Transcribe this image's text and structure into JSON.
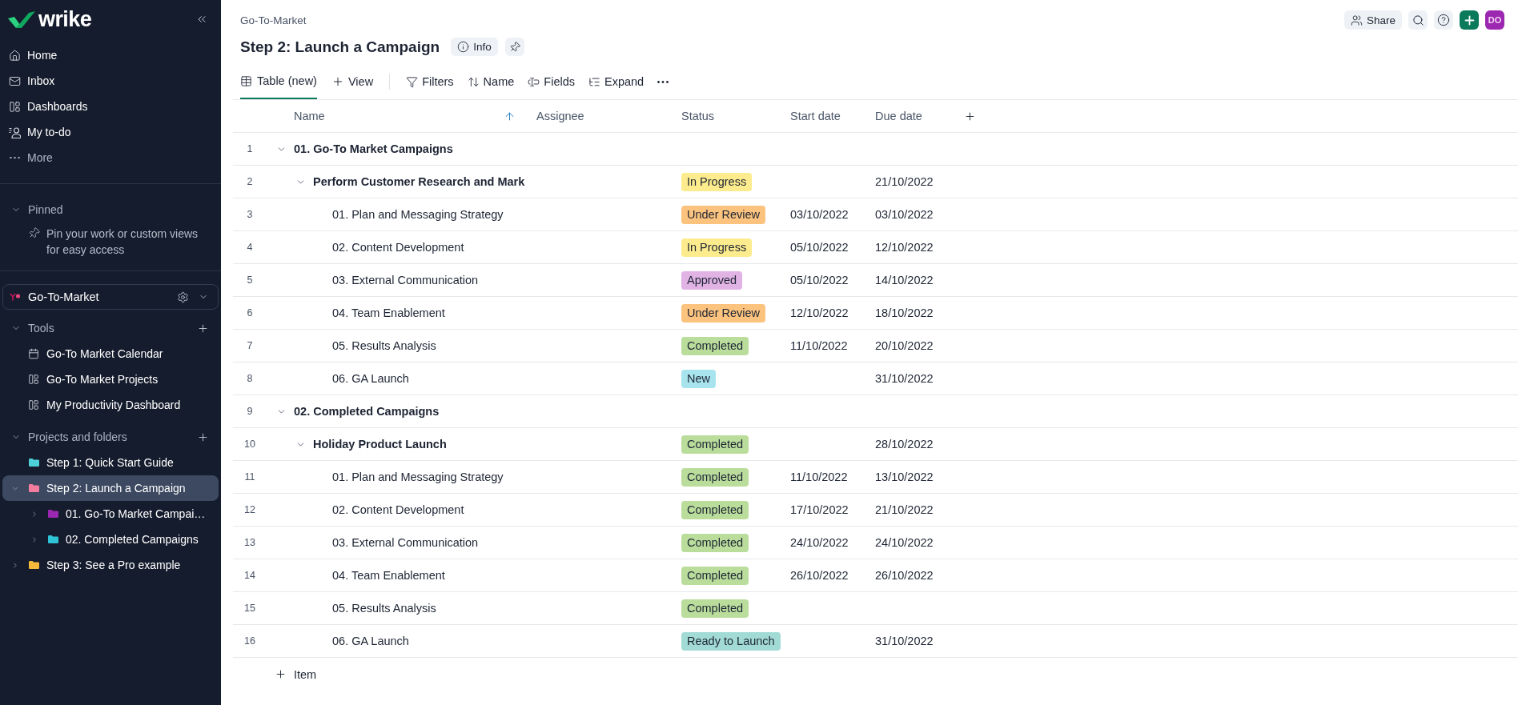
{
  "sidebar": {
    "logo": "wrike",
    "nav": [
      {
        "kind": "home",
        "label": "Home"
      },
      {
        "kind": "inbox",
        "label": "Inbox"
      },
      {
        "kind": "dashboards",
        "label": "Dashboards"
      },
      {
        "kind": "todo",
        "label": "My to-do"
      },
      {
        "kind": "more",
        "label": "More"
      }
    ],
    "pinned": {
      "title": "Pinned",
      "expanded": true,
      "hint": "Pin your work or custom views for easy access"
    },
    "space": {
      "name": "Go-To-Market"
    },
    "tools": {
      "title": "Tools",
      "expanded": true,
      "items": [
        {
          "kind": "calendar",
          "label": "Go-To Market Calendar"
        },
        {
          "kind": "dashboard",
          "label": "Go-To Market Projects"
        },
        {
          "kind": "dashboard",
          "label": "My Productivity Dashboard"
        }
      ]
    },
    "projects": {
      "title": "Projects and folders",
      "expanded": true,
      "items": [
        {
          "label": "Step 1: Quick Start Guide",
          "color": "#4fd1d9",
          "expandable": false,
          "expanded": false,
          "selected": false
        },
        {
          "label": "Step 2: Launch a Campaign",
          "color": "#f47c9c",
          "expandable": true,
          "expanded": true,
          "selected": true,
          "children": [
            {
              "label": "01. Go-To Market Campai…",
              "color": "#9c27b0",
              "expandable": true,
              "expanded": false,
              "selected": false
            },
            {
              "label": "02. Completed Campaigns",
              "color": "#2ec4d6",
              "expandable": true,
              "expanded": false,
              "selected": false
            }
          ]
        },
        {
          "label": "Step 3: See a Pro example",
          "color": "#f6b93b",
          "expandable": true,
          "expanded": false,
          "selected": false
        }
      ]
    }
  },
  "header": {
    "breadcrumb": "Go-To-Market",
    "title": "Step 2: Launch a Campaign",
    "info_button": "Info",
    "share_button": "Share",
    "avatar": "DO"
  },
  "toolbar": {
    "views": [
      {
        "label": "Table (new)",
        "selected": true
      }
    ],
    "add_view": "View",
    "actions": [
      {
        "kind": "filter",
        "label": "Filters"
      },
      {
        "kind": "sort",
        "label": "Name"
      },
      {
        "kind": "fields",
        "label": "Fields"
      },
      {
        "kind": "expand",
        "label": "Expand"
      }
    ]
  },
  "table": {
    "columns": [
      {
        "label": "Name",
        "sorted": true
      },
      {
        "label": "Assignee",
        "sorted": false
      },
      {
        "label": "Status",
        "sorted": false
      },
      {
        "label": "Start date",
        "sorted": false
      },
      {
        "label": "Due date",
        "sorted": false
      }
    ],
    "rows": [
      {
        "number": "1",
        "name": "01. Go-To Market Campaigns",
        "expanded": true,
        "children": [
          {
            "number": "2",
            "name": "Perform Customer Research and Mark",
            "expanded": true,
            "status": {
              "label": "In Progress",
              "color": "#fdec8d"
            },
            "due": "21/10/2022",
            "children": [
              {
                "number": "3",
                "name": "01. Plan and Messaging Strategy",
                "status": {
                  "label": "Under Review",
                  "color": "#fbc37e"
                },
                "start": "03/10/2022",
                "due": "03/10/2022"
              },
              {
                "number": "4",
                "name": "02. Content Development",
                "status": {
                  "label": "In Progress",
                  "color": "#fdec8d"
                },
                "start": "05/10/2022",
                "due": "12/10/2022"
              },
              {
                "number": "5",
                "name": "03. External Communication",
                "status": {
                  "label": "Approved",
                  "color": "#e0b3e4"
                },
                "start": "05/10/2022",
                "due": "14/10/2022"
              },
              {
                "number": "6",
                "name": "04. Team Enablement",
                "status": {
                  "label": "Under Review",
                  "color": "#fbc37e"
                },
                "start": "12/10/2022",
                "due": "18/10/2022"
              },
              {
                "number": "7",
                "name": "05. Results Analysis",
                "status": {
                  "label": "Completed",
                  "color": "#badd9c"
                },
                "start": "11/10/2022",
                "due": "20/10/2022"
              },
              {
                "number": "8",
                "name": "06. GA Launch",
                "status": {
                  "label": "New",
                  "color": "#a7e4ee"
                },
                "due": "31/10/2022"
              }
            ]
          }
        ]
      },
      {
        "number": "9",
        "name": "02. Completed Campaigns",
        "expanded": true,
        "children": [
          {
            "number": "10",
            "name": "Holiday Product Launch",
            "expanded": true,
            "status": {
              "label": "Completed",
              "color": "#badd9c"
            },
            "due": "28/10/2022",
            "children": [
              {
                "number": "11",
                "name": "01. Plan and Messaging Strategy",
                "status": {
                  "label": "Completed",
                  "color": "#badd9c"
                },
                "start": "11/10/2022",
                "due": "13/10/2022"
              },
              {
                "number": "12",
                "name": "02. Content Development",
                "status": {
                  "label": "Completed",
                  "color": "#badd9c"
                },
                "start": "17/10/2022",
                "due": "21/10/2022"
              },
              {
                "number": "13",
                "name": "03. External Communication",
                "status": {
                  "label": "Completed",
                  "color": "#badd9c"
                },
                "start": "24/10/2022",
                "due": "24/10/2022"
              },
              {
                "number": "14",
                "name": "04. Team Enablement",
                "status": {
                  "label": "Completed",
                  "color": "#badd9c"
                },
                "start": "26/10/2022",
                "due": "26/10/2022"
              },
              {
                "number": "15",
                "name": "05. Results Analysis",
                "status": {
                  "label": "Completed",
                  "color": "#badd9c"
                }
              },
              {
                "number": "16",
                "name": "06. GA Launch",
                "status": {
                  "label": "Ready to Launch",
                  "color": "#a2dbd6"
                },
                "due": "31/10/2022"
              }
            ]
          }
        ]
      }
    ],
    "add_item": "Item"
  }
}
